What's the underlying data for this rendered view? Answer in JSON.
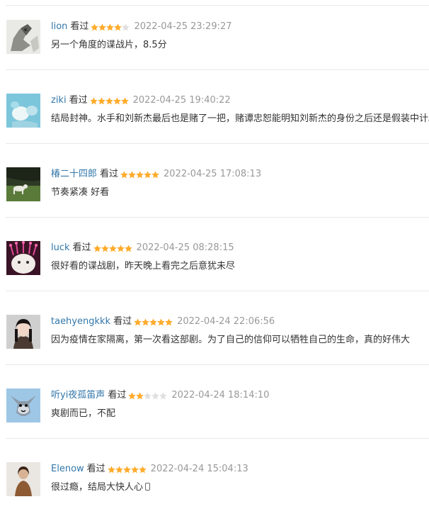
{
  "comments": [
    {
      "user": "lion",
      "status": "看过",
      "rating": 4,
      "time": "2022-04-25 23:29:27",
      "content": "另一个角度的谍战片，8.5分"
    },
    {
      "user": "ziki",
      "status": "看过",
      "rating": 5,
      "time": "2022-04-25 19:40:22",
      "content": "结局封神。水手和刘新杰最后也是赌了一把，赌谭忠恕能明知刘新杰的身份之后还是假装中计。"
    },
    {
      "user": "椿二十四郎",
      "status": "看过",
      "rating": 5,
      "time": "2022-04-25 17:08:13",
      "content": "节奏紧凑 好看"
    },
    {
      "user": "luck",
      "status": "看过",
      "rating": 5,
      "time": "2022-04-25 08:28:15",
      "content": "很好看的谍战剧，昨天晚上看完之后意犹未尽"
    },
    {
      "user": "taehyengkkk",
      "status": "看过",
      "rating": 5,
      "time": "2022-04-24 22:06:56",
      "content": "因为疫情在家隔离，第一次看这部剧。为了自己的信仰可以牺牲自己的生命，真的好伟大"
    },
    {
      "user": "听yi夜孤笛声",
      "status": "看过",
      "rating": 2,
      "time": "2022-04-24 18:14:10",
      "content": "爽剧而已，不配"
    },
    {
      "user": "Elenow",
      "status": "看过",
      "rating": 5,
      "time": "2022-04-24 15:04:13",
      "content": "很过瘾，结局大快人心"
    }
  ],
  "colors": {
    "username": "#3377aa",
    "star_on": "#ffac2d",
    "star_off": "#e0e0e0",
    "time": "#999999",
    "divider": "#e8e8e8"
  },
  "icons": {
    "star": "star-icon"
  }
}
